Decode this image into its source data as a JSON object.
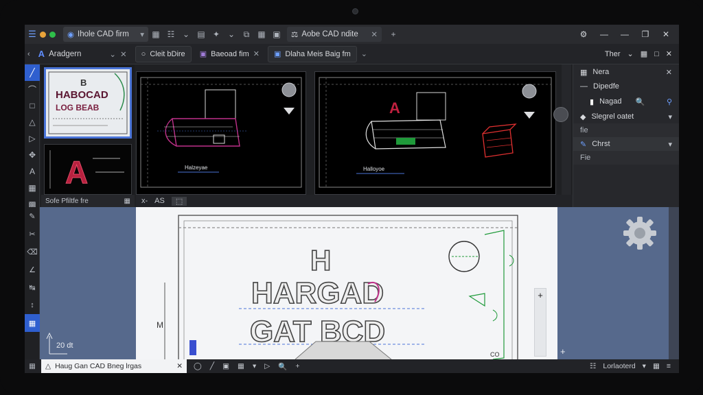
{
  "titlebar": {
    "tab_main_label": "Ihole CAD firm",
    "tab_doc_label": "Aobe CAD ndite",
    "new_tab": "+"
  },
  "tabbar": {
    "workspace_label": "Aradgern",
    "file_tabs": [
      "Cleit bDire",
      "Baeoad fim",
      "Dlaha Meis Baig fm"
    ],
    "right_label": "Ther"
  },
  "thumbnails": {
    "thumb1_line1": "B",
    "thumb1_line2": "HABOCAD",
    "thumb1_line3": "LOG BEAB",
    "footer_text": "Sofe Pfiltfe fre"
  },
  "viewports": {
    "vp1_label": "Halzeyae",
    "vp2_label": "Halloyoe",
    "vp2_letter": "A",
    "bar_icons": [
      "x-",
      "AS",
      "⬚"
    ]
  },
  "properties": {
    "title": "Nera",
    "section_header": "Dipedfe",
    "item_label": "Nagad",
    "dropdown1_label": "Slegrel oatet",
    "field1_label": "fie",
    "dropdown2_label": "Chrst",
    "field2_label": "Fie"
  },
  "drawing": {
    "line1": "H",
    "line2": "HARGAD",
    "line3": "GAT BCD",
    "side_label": "M",
    "dim_label": "CO"
  },
  "coord_readout": "20 dt",
  "statusbar": {
    "doc_tab_label": "Haug Gan CAD Bneg lrgas",
    "right_label": "Lorlaoterd"
  },
  "colors": {
    "accent": "#2f5fcf",
    "magenta_lines": "#c0308a",
    "green_lines": "#1f9a3a"
  }
}
